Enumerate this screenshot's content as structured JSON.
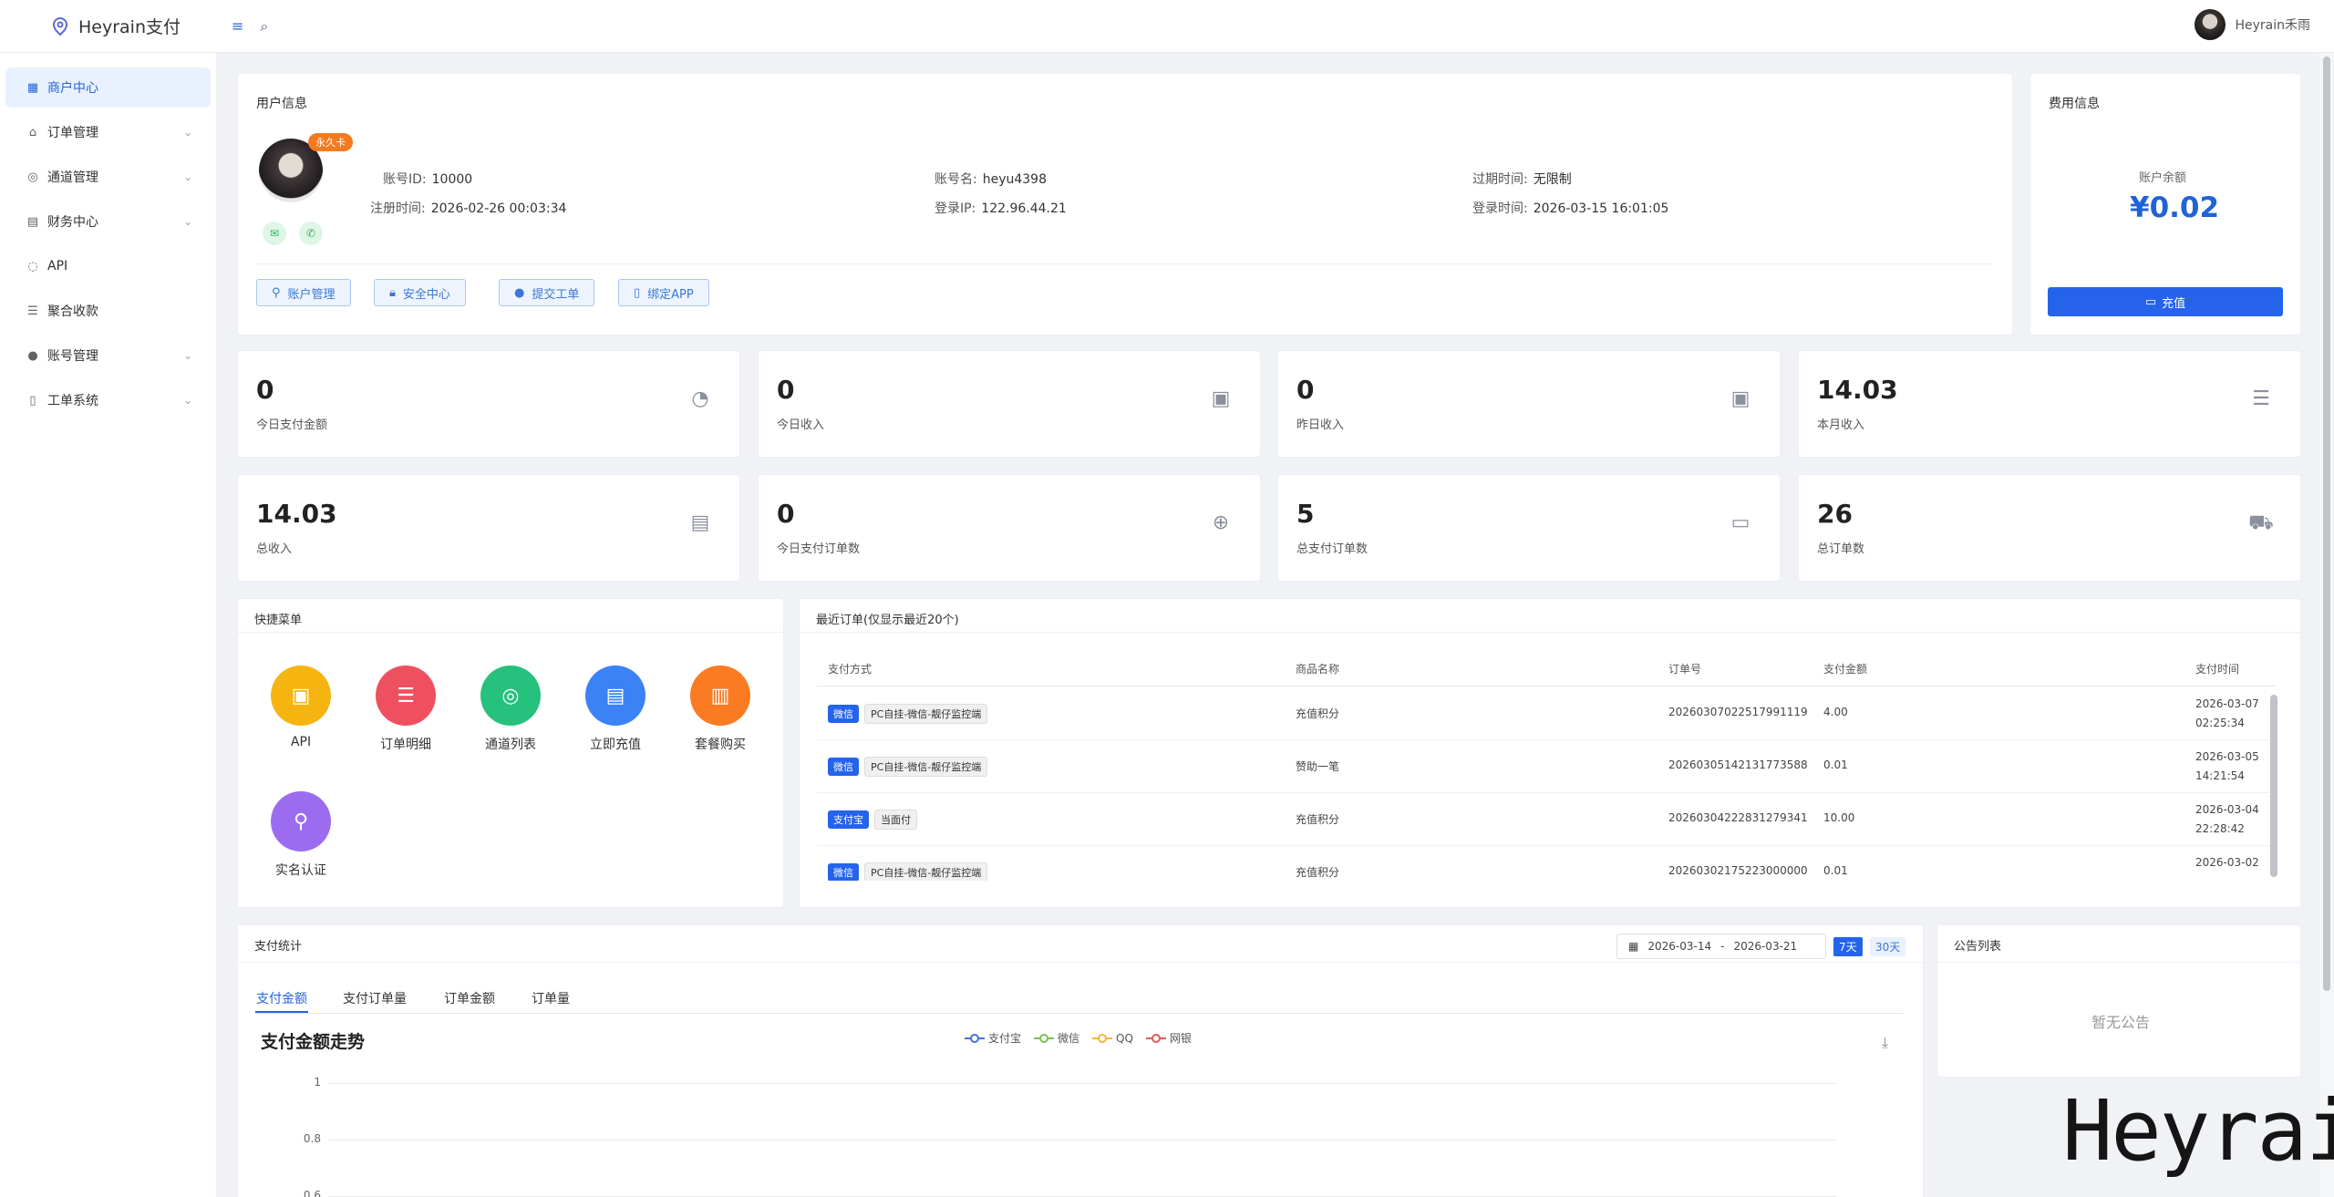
{
  "brand": {
    "name": "Heyrain支付"
  },
  "topbar": {
    "user": "Heyrain禾雨"
  },
  "sidebar": [
    {
      "label": "商户中心",
      "icon": "grid-icon",
      "active": true
    },
    {
      "label": "订单管理",
      "icon": "bag-icon",
      "chev": true
    },
    {
      "label": "通道管理",
      "icon": "channel-icon",
      "chev": true
    },
    {
      "label": "财务中心",
      "icon": "finance-icon",
      "chev": true
    },
    {
      "label": "API",
      "icon": "chip-icon"
    },
    {
      "label": "聚合收款",
      "icon": "coins-icon"
    },
    {
      "label": "账号管理",
      "icon": "person-icon",
      "chev": true
    },
    {
      "label": "工单系统",
      "icon": "book-icon",
      "chev": true
    }
  ],
  "user_info": {
    "title": "用户信息",
    "badge": "永久卡",
    "account_id_label": "账号ID:",
    "account_id": "10000",
    "register_label": "注册时间:",
    "register_time": "2026-02-26 00:03:34",
    "account_name_label": "账号名:",
    "account_name": "heyu4398",
    "login_ip_label": "登录IP:",
    "login_ip": "122.96.44.21",
    "expire_label": "过期时间:",
    "expire": "无限制",
    "login_time_label": "登录时间:",
    "login_time": "2026-03-15 16:01:05",
    "buttons": [
      "账户管理",
      "安全中心",
      "提交工单",
      "绑定APP"
    ]
  },
  "fee": {
    "title": "费用信息",
    "balance_label": "账户余额",
    "balance": "¥0.02",
    "recharge": "充值"
  },
  "stats": [
    {
      "num": "0",
      "label": "今日支付金额",
      "icon": "gauge-icon"
    },
    {
      "num": "0",
      "label": "今日收入",
      "icon": "wallet-icon"
    },
    {
      "num": "0",
      "label": "昨日收入",
      "icon": "wallet-icon"
    },
    {
      "num": "14.03",
      "label": "本月收入",
      "icon": "database-icon"
    },
    {
      "num": "14.03",
      "label": "总收入",
      "icon": "cash-icon"
    },
    {
      "num": "0",
      "label": "今日支付订单数",
      "icon": "crosshair-icon"
    },
    {
      "num": "5",
      "label": "总支付订单数",
      "icon": "card-icon"
    },
    {
      "num": "26",
      "label": "总订单数",
      "icon": "cart-icon"
    }
  ],
  "quick": {
    "title": "快捷菜单",
    "items": [
      {
        "label": "API",
        "color": "#f5b40f",
        "icon": "chip-icon"
      },
      {
        "label": "订单明细",
        "color": "#ef5060",
        "icon": "database-icon"
      },
      {
        "label": "通道列表",
        "color": "#27c17e",
        "icon": "channel-icon"
      },
      {
        "label": "立即充值",
        "color": "#3b82f6",
        "icon": "wallet-icon"
      },
      {
        "label": "套餐购买",
        "color": "#fa7b22",
        "icon": "clipboard-icon"
      },
      {
        "label": "实名认证",
        "color": "#9b6cf0",
        "icon": "person-icon"
      }
    ]
  },
  "orders": {
    "title": "最近订单(仅显示最近20个)",
    "headers": [
      "支付方式",
      "商品名称",
      "订单号",
      "支付金额",
      "支付时间"
    ],
    "rows": [
      {
        "tag": "微信",
        "channel": "PC自挂-微信-靓仔监控端",
        "product": "充值积分",
        "order": "20260307022517991119",
        "amount": "4.00",
        "date": "2026-03-07",
        "time": "02:25:34"
      },
      {
        "tag": "微信",
        "channel": "PC自挂-微信-靓仔监控端",
        "product": "赞助一笔",
        "order": "20260305142131773588",
        "amount": "0.01",
        "date": "2026-03-05",
        "time": "14:21:54"
      },
      {
        "tag": "支付宝",
        "channel": "当面付",
        "product": "充值积分",
        "order": "20260304222831279341",
        "amount": "10.00",
        "date": "2026-03-04",
        "time": "22:28:42"
      },
      {
        "tag": "微信",
        "channel": "PC自挂-微信-靓仔监控端",
        "product": "充值积分",
        "order": "20260302175223000000",
        "amount": "0.01",
        "date": "2026-03-02",
        "time": ""
      }
    ]
  },
  "pay_stats": {
    "title": "支付统计",
    "date_from": "2026-03-14",
    "date_sep": "-",
    "date_to": "2026-03-21",
    "btn7": "7天",
    "btn30": "30天",
    "tabs": [
      "支付金额",
      "支付订单量",
      "订单金额",
      "订单量"
    ]
  },
  "chart_data": {
    "type": "line",
    "title": "支付金额走势",
    "series": [
      {
        "name": "支付宝",
        "color": "#4a6fe0",
        "values": []
      },
      {
        "name": "微信",
        "color": "#7cc24f",
        "values": []
      },
      {
        "name": "QQ",
        "color": "#f5b63a",
        "values": []
      },
      {
        "name": "网银",
        "color": "#e55a5a",
        "values": []
      }
    ],
    "yticks": [
      "1",
      "0.8",
      "0.6"
    ],
    "ylim": [
      0,
      1
    ]
  },
  "announce": {
    "title": "公告列表",
    "empty": "暂无公告"
  },
  "watermark": "Heyrain"
}
